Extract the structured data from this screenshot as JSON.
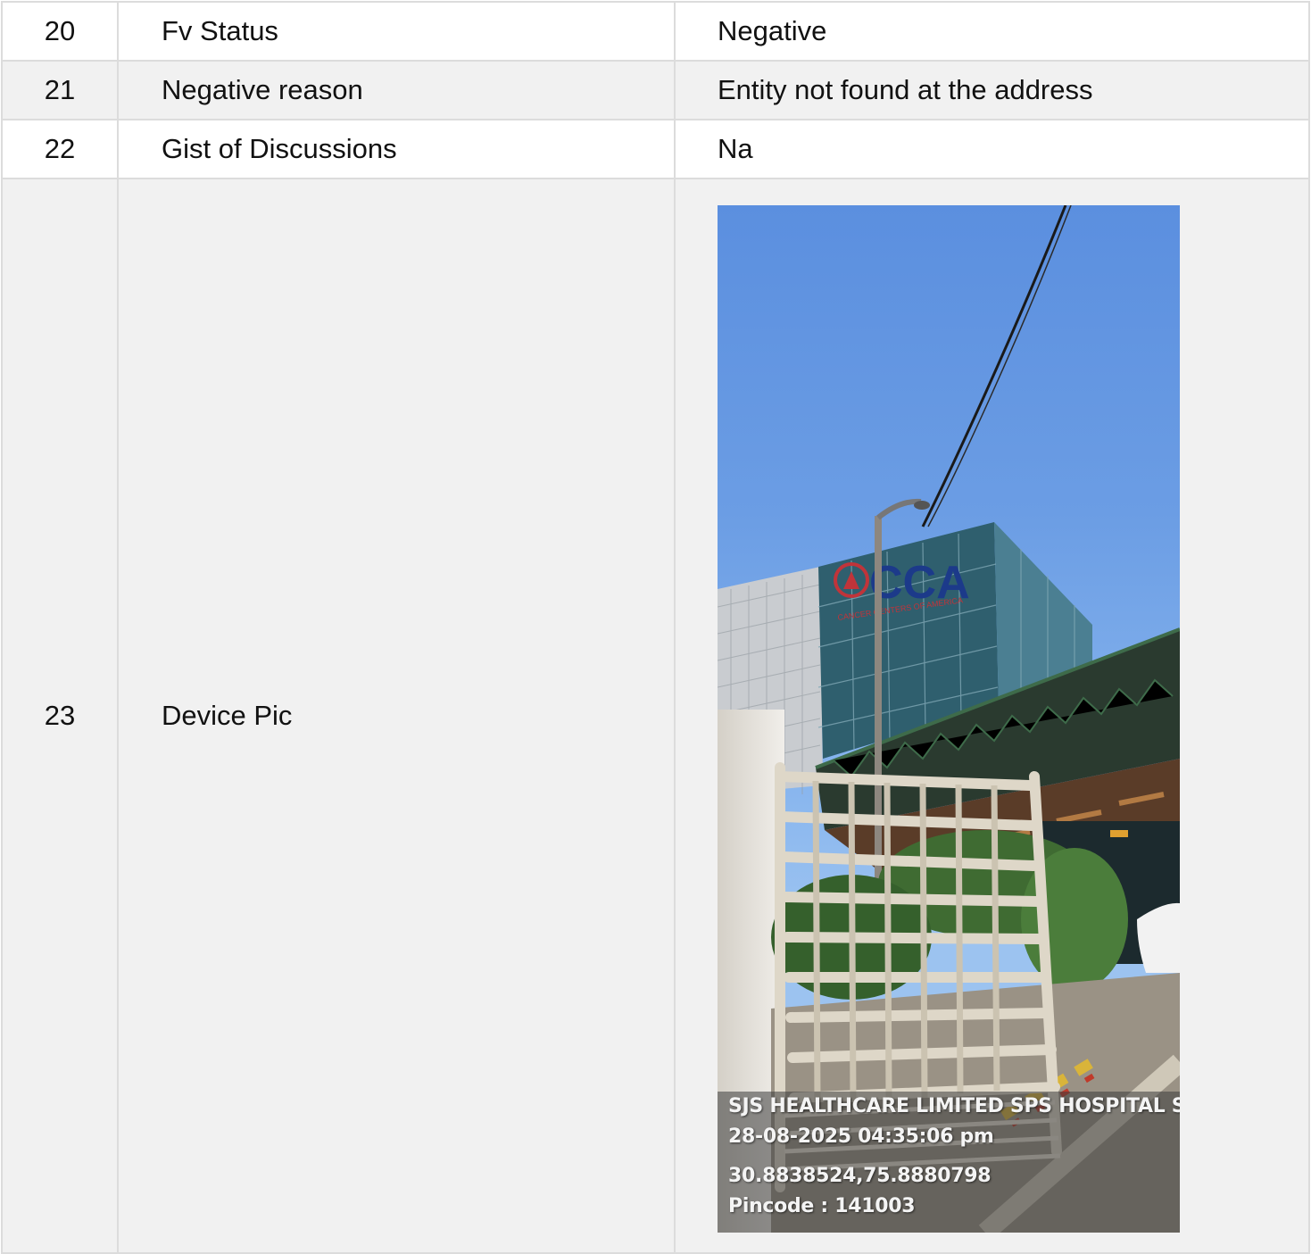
{
  "rows": [
    {
      "num": "20",
      "field": "Fv Status",
      "value": "Negative"
    },
    {
      "num": "21",
      "field": "Negative reason",
      "value": "Entity not found at the address"
    },
    {
      "num": "22",
      "field": "Gist of Discussions",
      "value": "Na"
    },
    {
      "num": "23",
      "field": "Device Pic"
    }
  ],
  "photo": {
    "sign_text": "CCA",
    "sign_subtext": "CANCER CENTERS OF AMERICA",
    "overlay_lines": [
      "SJS HEALTHCARE LIMITED SPS HOSPITAL S",
      "28-08-2025 04:35:06 pm",
      "30.8838524,75.8880798",
      "Pincode : 141003"
    ]
  },
  "colors": {
    "border": "#dcdcdc",
    "alt_row": "#f1f1f1",
    "sky": "#6b9de4",
    "sign_blue": "#1c3a8a",
    "sign_red": "#c0343a"
  }
}
